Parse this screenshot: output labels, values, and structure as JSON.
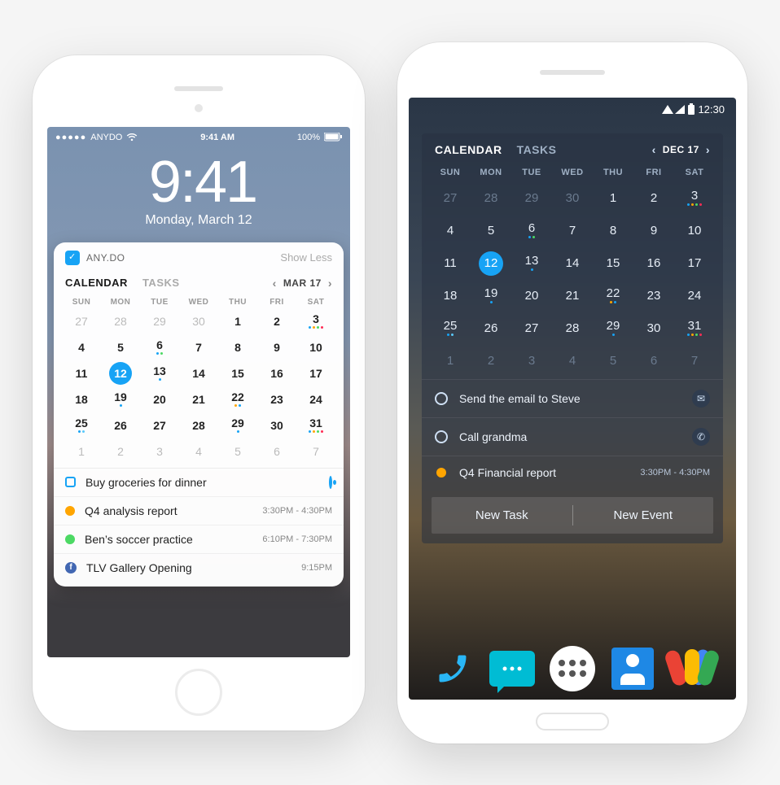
{
  "ios": {
    "status": {
      "carrier": "ANYDO",
      "time": "9:41 AM",
      "battery": "100%"
    },
    "lock": {
      "time": "9:41",
      "date": "Monday, March 12"
    },
    "widget": {
      "app_name": "ANY.DO",
      "show_less": "Show Less",
      "tabs": {
        "calendar": "CALENDAR",
        "tasks": "TASKS"
      },
      "datepick": "MAR 17",
      "dow": [
        "SUN",
        "MON",
        "TUE",
        "WED",
        "THU",
        "FRI",
        "SAT"
      ],
      "weeks": [
        [
          {
            "n": "27",
            "out": true
          },
          {
            "n": "28",
            "out": true
          },
          {
            "n": "29",
            "out": true
          },
          {
            "n": "30",
            "out": true
          },
          {
            "n": "1"
          },
          {
            "n": "2"
          },
          {
            "n": "3",
            "marks": [
              "b",
              "o",
              "g",
              "r"
            ]
          }
        ],
        [
          {
            "n": "4"
          },
          {
            "n": "5"
          },
          {
            "n": "6",
            "marks": [
              "b",
              "g"
            ]
          },
          {
            "n": "7"
          },
          {
            "n": "8"
          },
          {
            "n": "9"
          },
          {
            "n": "10"
          }
        ],
        [
          {
            "n": "11"
          },
          {
            "n": "12",
            "sel": true
          },
          {
            "n": "13",
            "marks": [
              "b"
            ]
          },
          {
            "n": "14"
          },
          {
            "n": "15"
          },
          {
            "n": "16"
          },
          {
            "n": "17"
          }
        ],
        [
          {
            "n": "18"
          },
          {
            "n": "19",
            "marks": [
              "b"
            ]
          },
          {
            "n": "20"
          },
          {
            "n": "21"
          },
          {
            "n": "22",
            "marks": [
              "o",
              "b"
            ]
          },
          {
            "n": "23"
          },
          {
            "n": "24"
          }
        ],
        [
          {
            "n": "25",
            "marks": [
              "b",
              "t"
            ]
          },
          {
            "n": "26"
          },
          {
            "n": "27"
          },
          {
            "n": "28"
          },
          {
            "n": "29",
            "marks": [
              "b"
            ]
          },
          {
            "n": "30"
          },
          {
            "n": "31",
            "marks": [
              "b",
              "o",
              "g",
              "r"
            ]
          }
        ],
        [
          {
            "n": "1",
            "out": true
          },
          {
            "n": "2",
            "out": true
          },
          {
            "n": "3",
            "out": true
          },
          {
            "n": "4",
            "out": true
          },
          {
            "n": "5",
            "out": true
          },
          {
            "n": "6",
            "out": true
          },
          {
            "n": "7",
            "out": true
          }
        ]
      ],
      "items": [
        {
          "icon": "square",
          "label": "Buy groceries for dinner",
          "trail": "target"
        },
        {
          "icon": "orange",
          "label": "Q4 analysis report",
          "time": "3:30PM - 4:30PM"
        },
        {
          "icon": "green",
          "label": "Ben’s soccer practice",
          "time": "6:10PM - 7:30PM"
        },
        {
          "icon": "fb",
          "label": "TLV Gallery Opening",
          "time": "9:15PM"
        }
      ]
    }
  },
  "android": {
    "status": {
      "time": "12:30"
    },
    "widget": {
      "tabs": {
        "calendar": "CALENDAR",
        "tasks": "TASKS"
      },
      "datepick": "DEC 17",
      "dow": [
        "SUN",
        "MON",
        "TUE",
        "WED",
        "THU",
        "FRI",
        "SAT"
      ],
      "weeks": [
        [
          {
            "n": "27",
            "out": true
          },
          {
            "n": "28",
            "out": true
          },
          {
            "n": "29",
            "out": true
          },
          {
            "n": "30",
            "out": true
          },
          {
            "n": "1"
          },
          {
            "n": "2"
          },
          {
            "n": "3",
            "marks": [
              "b",
              "o",
              "g",
              "r"
            ]
          }
        ],
        [
          {
            "n": "4"
          },
          {
            "n": "5"
          },
          {
            "n": "6",
            "marks": [
              "b",
              "g"
            ]
          },
          {
            "n": "7"
          },
          {
            "n": "8"
          },
          {
            "n": "9"
          },
          {
            "n": "10"
          }
        ],
        [
          {
            "n": "11"
          },
          {
            "n": "12",
            "sel": true
          },
          {
            "n": "13",
            "marks": [
              "b"
            ]
          },
          {
            "n": "14"
          },
          {
            "n": "15"
          },
          {
            "n": "16"
          },
          {
            "n": "17"
          }
        ],
        [
          {
            "n": "18"
          },
          {
            "n": "19",
            "marks": [
              "b"
            ]
          },
          {
            "n": "20"
          },
          {
            "n": "21"
          },
          {
            "n": "22",
            "marks": [
              "o",
              "b"
            ]
          },
          {
            "n": "23"
          },
          {
            "n": "24"
          }
        ],
        [
          {
            "n": "25",
            "marks": [
              "b",
              "t"
            ]
          },
          {
            "n": "26"
          },
          {
            "n": "27"
          },
          {
            "n": "28"
          },
          {
            "n": "29",
            "marks": [
              "b"
            ]
          },
          {
            "n": "30"
          },
          {
            "n": "31",
            "marks": [
              "b",
              "o",
              "g",
              "r"
            ]
          }
        ],
        [
          {
            "n": "1",
            "out": true
          },
          {
            "n": "2",
            "out": true
          },
          {
            "n": "3",
            "out": true
          },
          {
            "n": "4",
            "out": true
          },
          {
            "n": "5",
            "out": true
          },
          {
            "n": "6",
            "out": true
          },
          {
            "n": "7",
            "out": true
          }
        ]
      ],
      "items": [
        {
          "icon": "ring",
          "label": "Send the email to Steve",
          "trail": "mail"
        },
        {
          "icon": "ring",
          "label": "Call grandma",
          "trail": "phone"
        },
        {
          "icon": "orange",
          "label": "Q4 Financial report",
          "time": "3:30PM - 4:30PM"
        }
      ],
      "actions": {
        "new_task": "New Task",
        "new_event": "New Event"
      }
    }
  }
}
